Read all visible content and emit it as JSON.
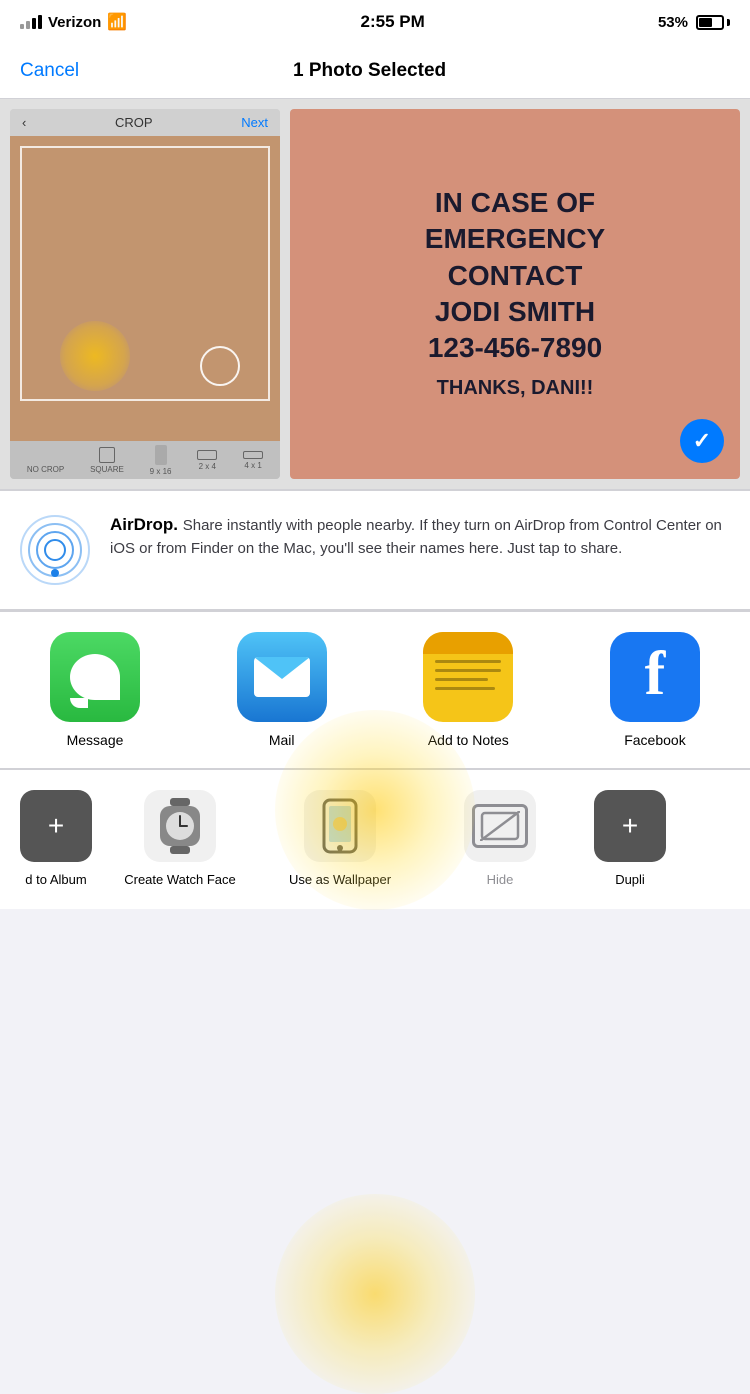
{
  "statusBar": {
    "carrier": "Verizon",
    "time": "2:55 PM",
    "battery": "53%",
    "wifi": true,
    "signal": 3
  },
  "navBar": {
    "cancel": "Cancel",
    "title": "1 Photo Selected"
  },
  "photoText": "IN CASE OF EMERGENCY CONTACT JODI SMITH 123-456-7890 THANKS, DANI!!",
  "cropLabel": "CROP",
  "cropNext": "Next",
  "airdrop": {
    "title": "AirDrop",
    "description": "Share instantly with people nearby. If they turn on AirDrop from Control Center on iOS or from Finder on the Mac, you'll see their names here. Just tap to share."
  },
  "apps": [
    {
      "id": "message",
      "label": "Message"
    },
    {
      "id": "mail",
      "label": "Mail"
    },
    {
      "id": "notes",
      "label": "Add to Notes"
    },
    {
      "id": "facebook",
      "label": "Facebook"
    }
  ],
  "actions": [
    {
      "id": "add-album",
      "label": "d to Album",
      "partial": true
    },
    {
      "id": "watch-face",
      "label": "Create Watch Face"
    },
    {
      "id": "wallpaper",
      "label": "Use as Wallpaper"
    },
    {
      "id": "hide",
      "label": "Hide",
      "dimmed": true
    },
    {
      "id": "duplicate",
      "label": "Dupli",
      "partial": true
    }
  ]
}
